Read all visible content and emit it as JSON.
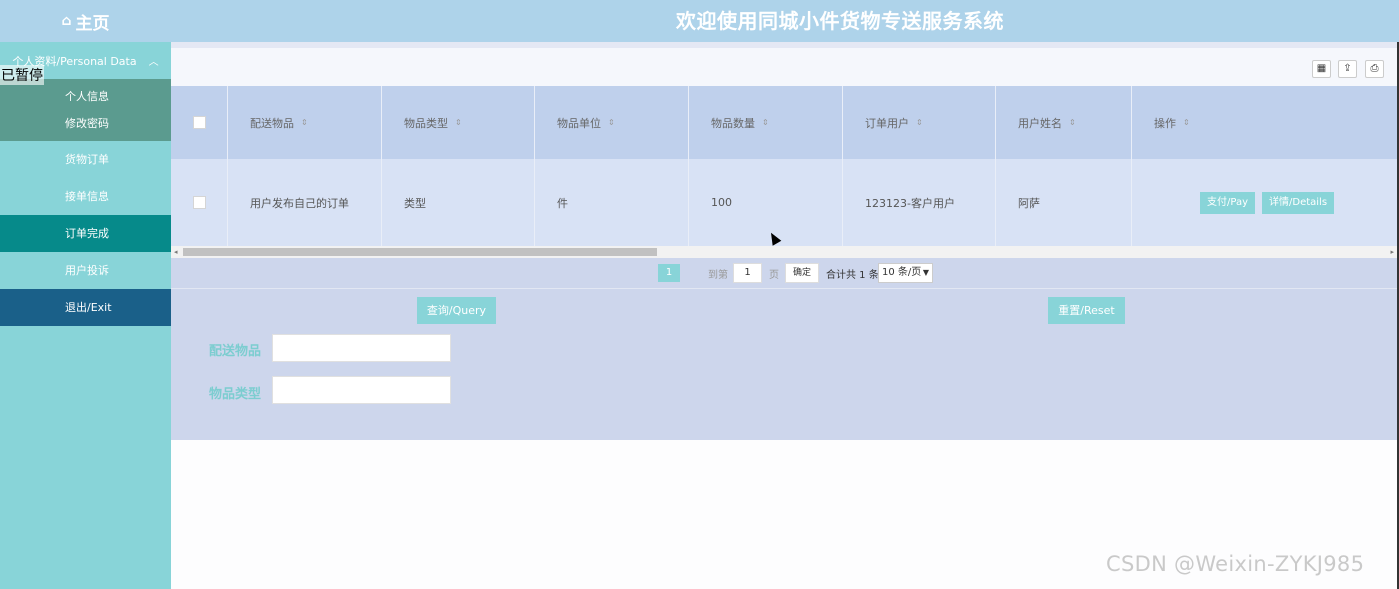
{
  "header": {
    "home_label": "主页",
    "home_icon": "⌂",
    "system_title": "欢迎使用同城小件货物专送服务系统"
  },
  "sidebar": {
    "group_label": "个人资料/Personal Data",
    "group_sub": [
      "个人信息",
      "修改密码"
    ],
    "items": [
      "货物订单",
      "接单信息",
      "订单完成",
      "用户投诉",
      "退出/Exit"
    ],
    "active_item": "订单完成"
  },
  "overlay_text": "已暂停",
  "toolbar_icons": [
    "grid-view-icon",
    "export-icon",
    "print-icon"
  ],
  "table": {
    "columns": [
      "配送物品",
      "物品类型",
      "物品单位",
      "物品数量",
      "订单用户",
      "用户姓名",
      "操作"
    ],
    "rows": [
      {
        "item": "用户发布自己的订单",
        "type": "类型",
        "unit": "件",
        "qty": "100",
        "user": "123123-客户用户",
        "name": "阿萨",
        "actions": [
          "支付/Pay",
          "详情/Details"
        ]
      }
    ]
  },
  "pager": {
    "current_page": "1",
    "goto_label": "到第",
    "goto_value": "1",
    "page_label": "页",
    "confirm": "确定",
    "total": "合计共 1 条",
    "page_size": "10 条/页"
  },
  "search": {
    "query_button": "查询/Query",
    "reset_button": "重置/Reset",
    "field1_label": "配送物品",
    "field2_label": "物品类型"
  },
  "watermark": "CSDN @Weixin-ZYKJ985",
  "colors": {
    "accent": "#88d4d8",
    "active": "#068a8a",
    "exit": "#1a6089",
    "header": "#aed3ea"
  }
}
